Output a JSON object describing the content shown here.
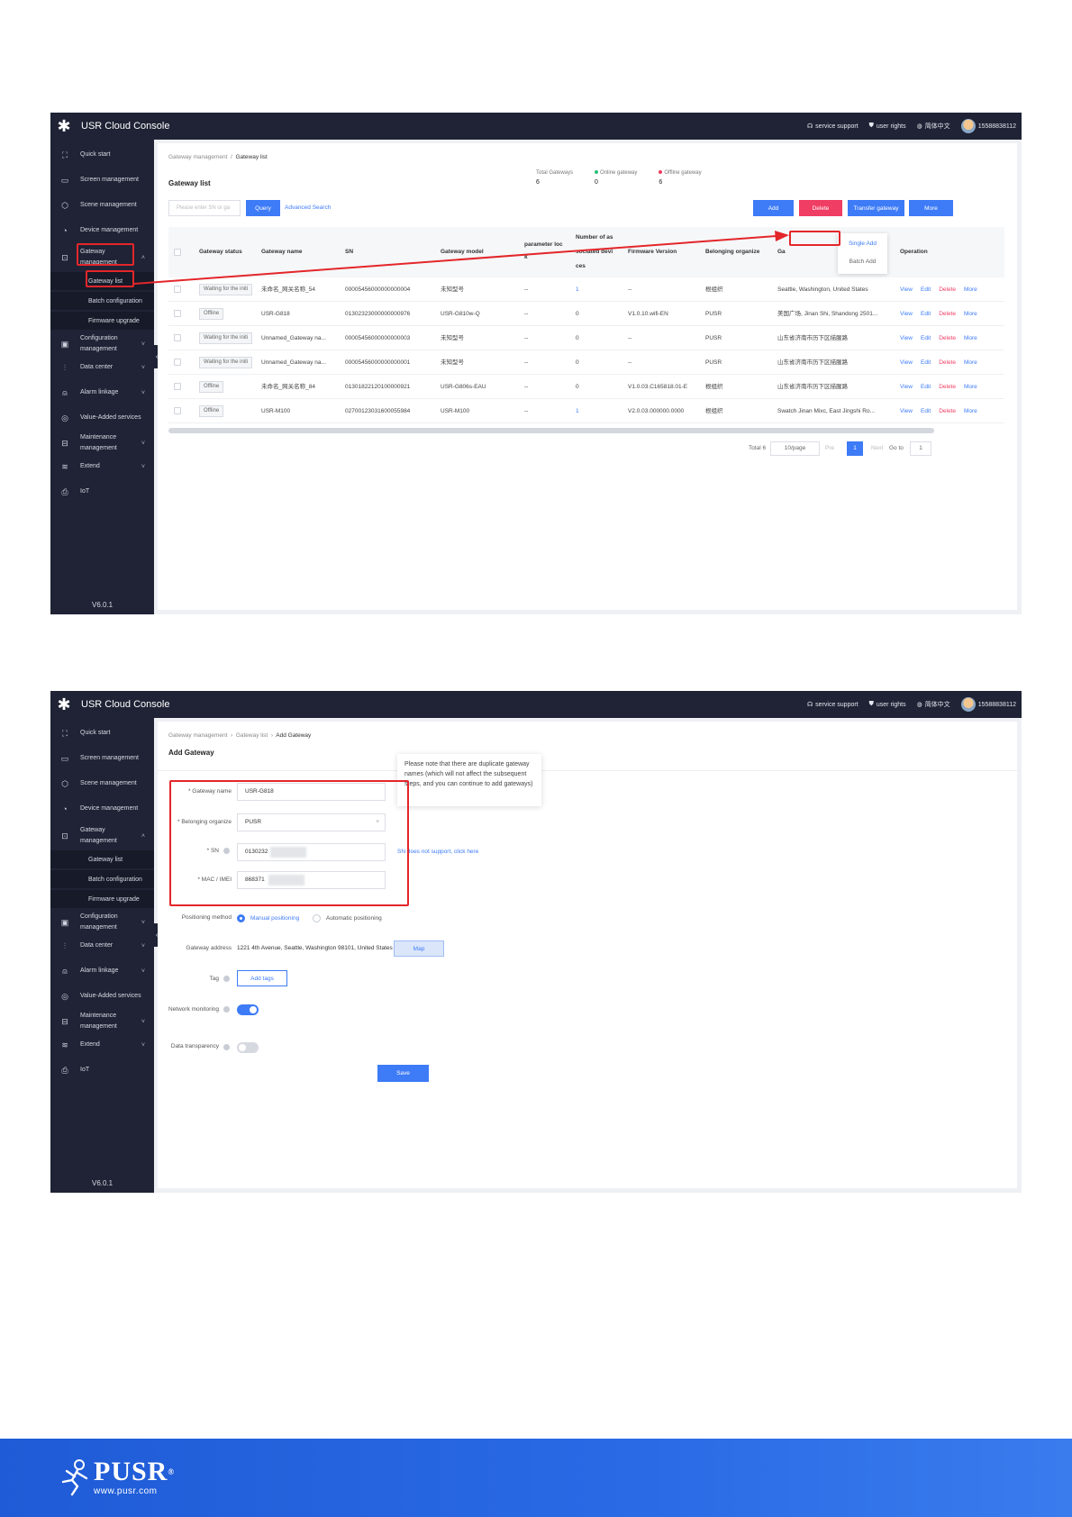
{
  "console": {
    "brand": "USR Cloud Console",
    "version": "V6.0.1",
    "top_links": [
      "service support",
      "user rights",
      "简体中文"
    ],
    "user": "15588838112"
  },
  "sidebar": {
    "items": [
      {
        "label": "Quick start",
        "icon": "rocket-icon"
      },
      {
        "label": "Screen management",
        "icon": "monitor-icon"
      },
      {
        "label": "Scene management",
        "icon": "cube-icon"
      },
      {
        "label": "Device management",
        "icon": "device-icon"
      },
      {
        "label": "Gateway management",
        "icon": "gateway-icon"
      },
      {
        "label": "Configuration management",
        "icon": "config-icon"
      },
      {
        "label": "Data center",
        "icon": "bar-chart-icon"
      },
      {
        "label": "Alarm linkage",
        "icon": "bell-icon"
      },
      {
        "label": "Value-Added services",
        "icon": "value-icon"
      },
      {
        "label": "Maintenance management",
        "icon": "maintenance-icon"
      },
      {
        "label": "Extend",
        "icon": "layers-icon"
      },
      {
        "label": "IoT",
        "icon": "iot-icon"
      }
    ],
    "sub_items": [
      "Gateway list",
      "Batch configuration",
      "Firmware upgrade"
    ]
  },
  "list_page": {
    "breadcrumb": [
      "Gateway management",
      "Gateway list"
    ],
    "title": "Gateway list",
    "stats": [
      {
        "label": "Total Gateways",
        "value": "6"
      },
      {
        "label": "Online gateway",
        "value": "0"
      },
      {
        "label": "Offline gateway",
        "value": "6"
      }
    ],
    "search_placeholder": "Please enter SN or ga",
    "query_label": "Query",
    "advanced_search": "Advanced Search",
    "buttons": {
      "add": "Add",
      "delete": "Delete",
      "transfer": "Transfer gateway",
      "more": "More"
    },
    "dropdown": [
      "Single Add",
      "Batch Add"
    ],
    "columns": [
      "Gateway status",
      "Gateway name",
      "SN",
      "Gateway model",
      "parameter loc",
      "k",
      "Number of as",
      "sociated devi",
      "ces",
      "Firmware Version",
      "Belonging organize",
      "Ga",
      "Operation"
    ],
    "rows": [
      {
        "status": "Waiting for the initi",
        "name": "未命名_网关名称_54",
        "sn": "00005456000000000004",
        "model": "未知型号",
        "param": "--",
        "num": "1",
        "fw": "--",
        "org": "根组织",
        "addr": "Seattle, Washington, United States"
      },
      {
        "status": "Offline",
        "name": "USR-G818",
        "sn": "01302323000000000976",
        "model": "USR-G810w-Q",
        "param": "--",
        "num": "0",
        "fw": "V1.0.10.wifi-EN",
        "org": "PUSR",
        "addr": "美国广场, Jinan Shi, Shandong 2501..."
      },
      {
        "status": "Waiting for the initi",
        "name": "Unnamed_Gateway na...",
        "sn": "00005456000000000003",
        "model": "未知型号",
        "param": "--",
        "num": "0",
        "fw": "--",
        "org": "PUSR",
        "addr": "山东省济南市历下区描腥路"
      },
      {
        "status": "Waiting for the initi",
        "name": "Unnamed_Gateway na...",
        "sn": "00005456000000000001",
        "model": "未知型号",
        "param": "--",
        "num": "0",
        "fw": "--",
        "org": "PUSR",
        "addr": "山东省济南市历下区描腥路"
      },
      {
        "status": "Offline",
        "name": "未命名_网关名称_84",
        "sn": "01301822120100000921",
        "model": "USR-G806s-EAU",
        "param": "--",
        "num": "0",
        "fw": "V1.0.03.C165818.01-E",
        "org": "根组织",
        "addr": "山东省济南市历下区描腥路"
      },
      {
        "status": "Offline",
        "name": "USR-M100",
        "sn": "02700123031600055984",
        "model": "USR-M100",
        "param": "--",
        "num": "1",
        "fw": "V2.0.03.000000.0000",
        "org": "根组织",
        "addr": "Swatch Jinan Mixc, East Jingshi Ro..."
      }
    ],
    "ops": [
      "View",
      "Edit",
      "Delete",
      "More"
    ],
    "pagination": {
      "total": "Total 6",
      "per_page": "10/page",
      "prev": "Pre",
      "current": "1",
      "next": "Next",
      "goto": "Go to",
      "goto_value": "1"
    }
  },
  "add_page": {
    "breadcrumb": [
      "Gateway management",
      "Gateway list",
      "Add Gateway"
    ],
    "title": "Add Gateway",
    "gateway_name_label": "* Gateway name",
    "gateway_name_value": "USR-G818",
    "org_label": "* Belonging organize",
    "org_value": "PUSR",
    "sn_label": "* SN",
    "sn_value": "0130232",
    "mac_label": "* MAC / IMEI",
    "mac_value": "868371",
    "sn_link": "SN does not support, click here",
    "tooltip": "Please note that there are duplicate gateway names (which will not affect the subsequent steps, and you can continue to add gateways)",
    "positioning_label": "Positioning method",
    "positioning_options": [
      "Manual positioning",
      "Automatic positioning"
    ],
    "address_label": "Gateway address",
    "address_value": "1221 4th Avenue, Seattle, Washington 98101, United States",
    "map_label": "Map",
    "tag_label": "Tag",
    "add_tags_label": "Add tags",
    "network_label": "Network monitoring",
    "network_on": true,
    "transparency_label": "Data transparency",
    "transparency_on": false,
    "save_label": "Save"
  },
  "footer": {
    "brand": "PUSR",
    "url": "www.pusr.com"
  },
  "colors": {
    "primary": "#3d7bf7",
    "danger": "#f03d63",
    "sidebar": "#1f2335",
    "highlight": "#e3262a",
    "footer": "#2a6ae5"
  }
}
